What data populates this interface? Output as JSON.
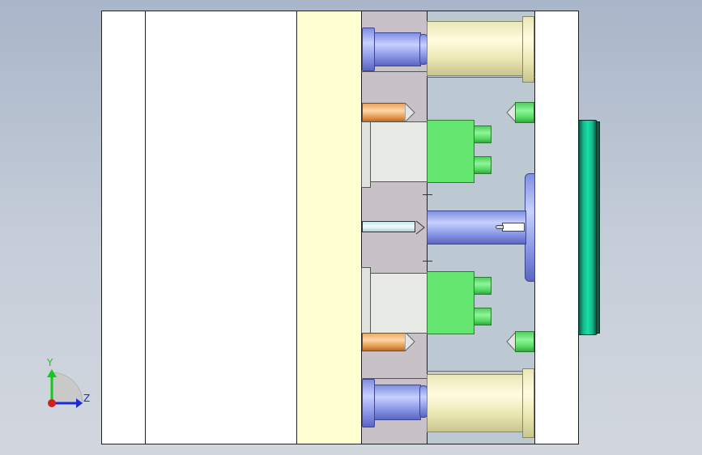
{
  "viewport": {
    "background": "#b4bfcf",
    "triad": {
      "y_label": "Y",
      "z_label": "Z",
      "colors": {
        "y": "#19c51f",
        "z": "#1d2bd6",
        "x": "#d22020"
      }
    }
  },
  "colors": {
    "plate_white": "#ffffff",
    "plate_yellow": "#ffffd2",
    "plate_mauve": "#c9c1c8",
    "plate_lightblue": "#bdc9d2",
    "blue_part": "#8a97e6",
    "cream_part": "#f3f1c8",
    "orange_part": "#f0a862",
    "green_part": "#63e56f",
    "teal_part": "#14b98a"
  }
}
